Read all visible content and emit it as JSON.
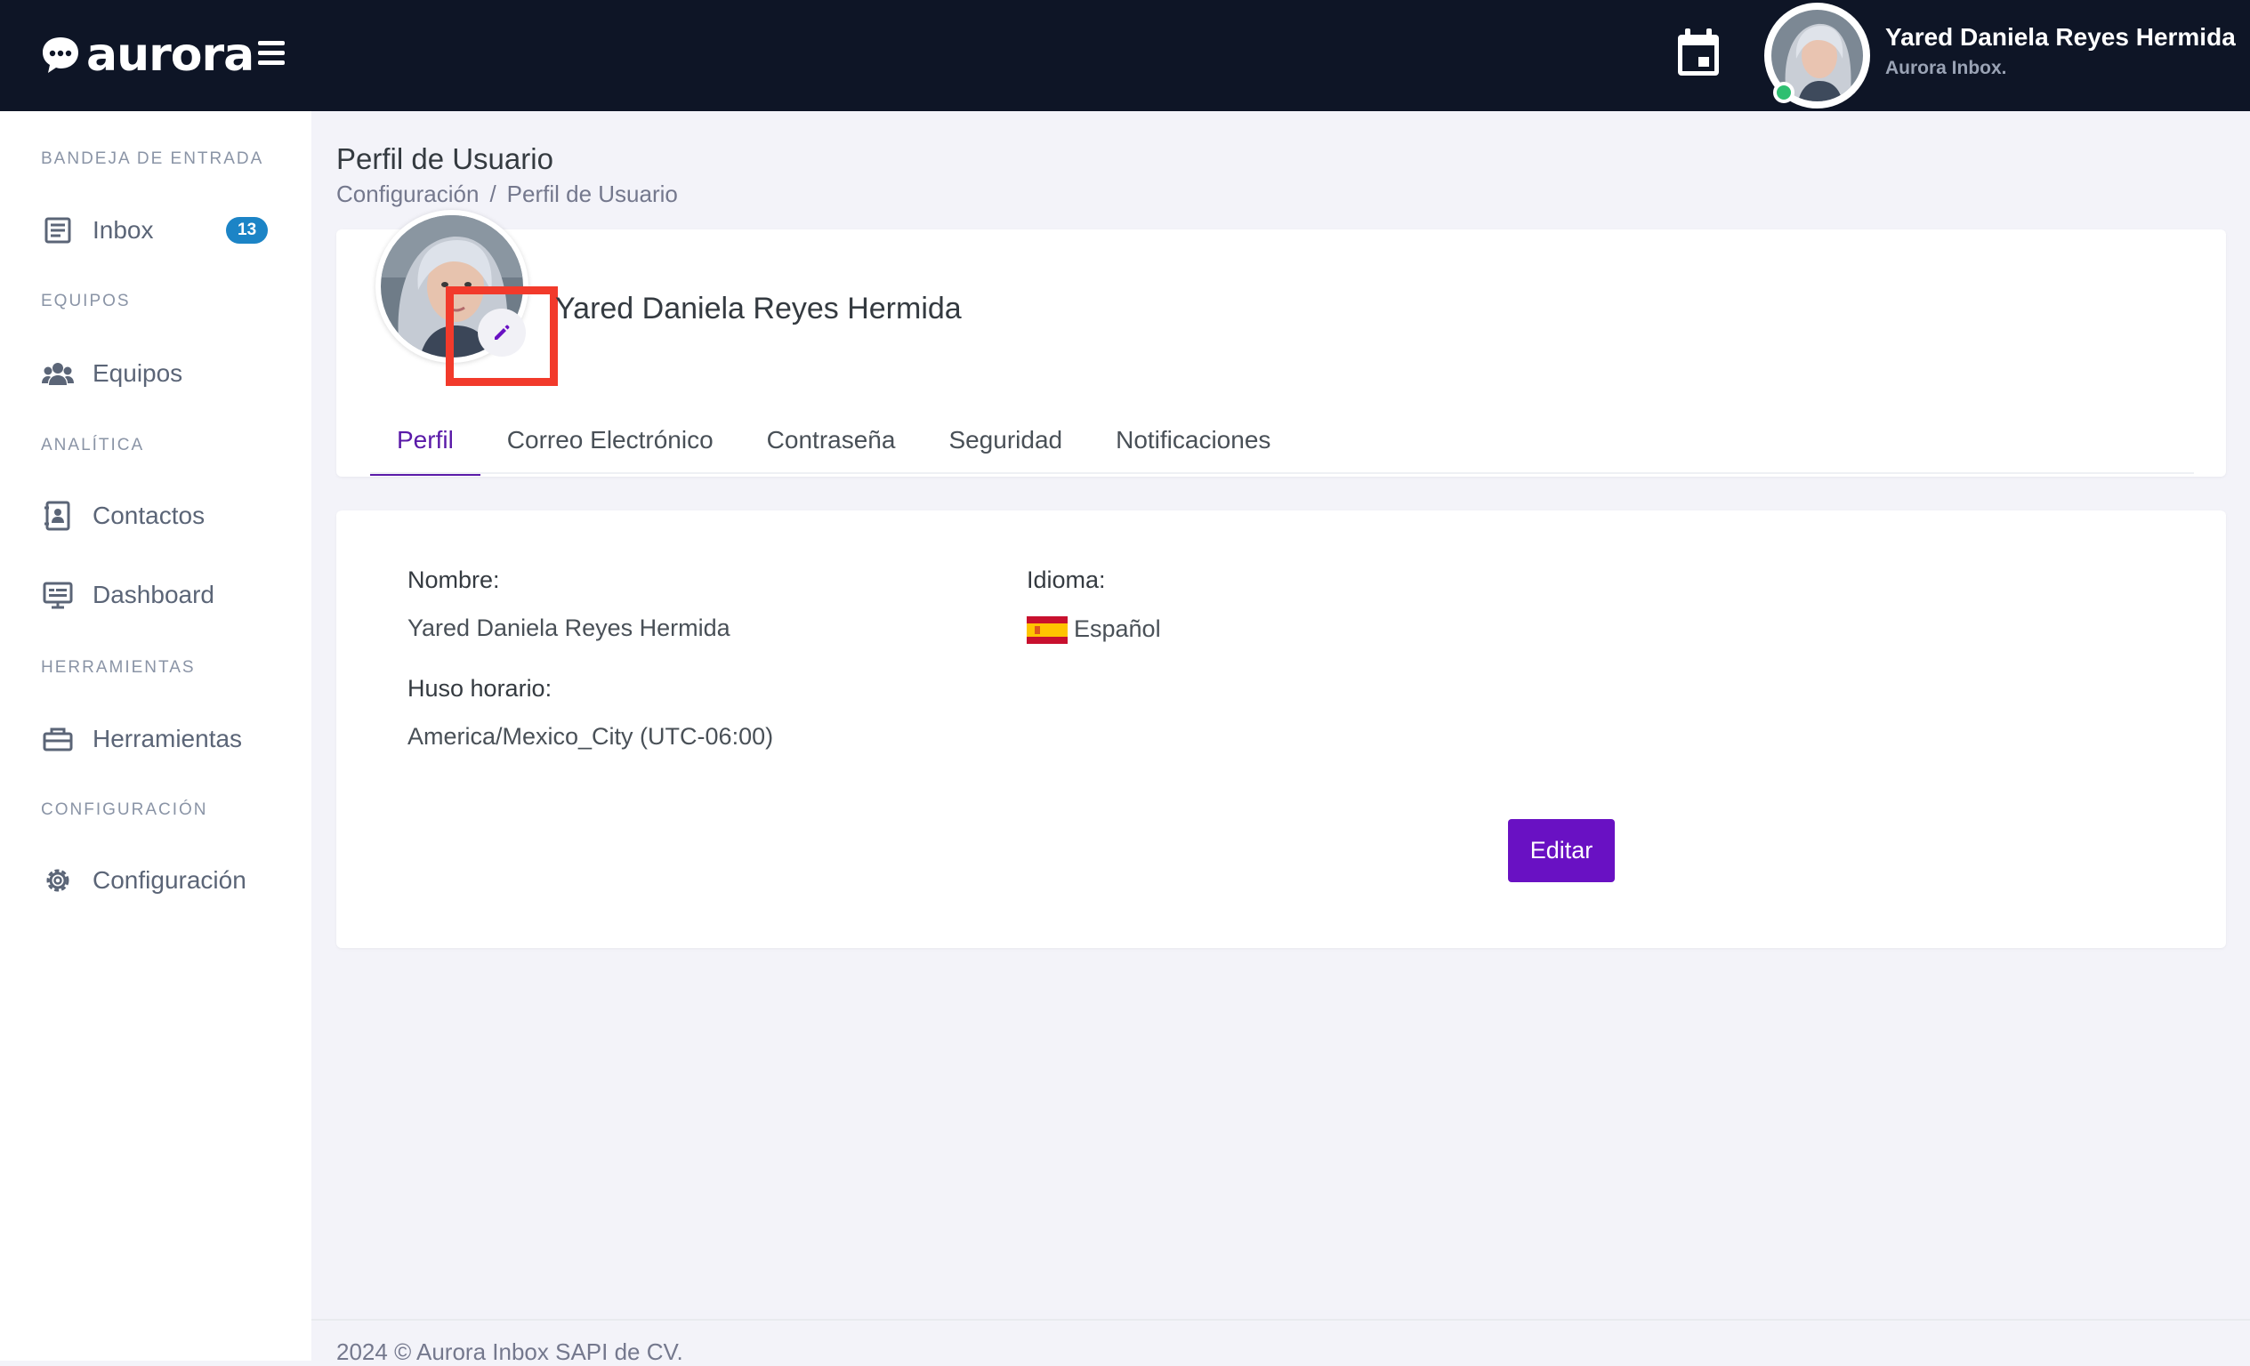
{
  "brand": {
    "name": "aurora"
  },
  "header": {
    "user_name": "Yared Daniela Reyes Hermida",
    "user_subtitle": "Aurora Inbox."
  },
  "sidebar": {
    "sections": [
      {
        "title": "Bandeja de entrada",
        "items": [
          {
            "label": "Inbox",
            "icon": "inbox-icon",
            "badge": "13"
          }
        ]
      },
      {
        "title": "Equipos",
        "items": [
          {
            "label": "Equipos",
            "icon": "users-icon"
          }
        ]
      },
      {
        "title": "Analítica",
        "items": [
          {
            "label": "Contactos",
            "icon": "contacts-icon"
          },
          {
            "label": "Dashboard",
            "icon": "monitor-icon"
          }
        ]
      },
      {
        "title": "Herramientas",
        "items": [
          {
            "label": "Herramientas",
            "icon": "toolbox-icon"
          }
        ]
      },
      {
        "title": "Configuración",
        "items": [
          {
            "label": "Configuración",
            "icon": "gear-icon"
          }
        ]
      }
    ]
  },
  "page": {
    "title": "Perfil de Usuario",
    "breadcrumb": [
      "Configuración",
      "Perfil de Usuario"
    ]
  },
  "profile": {
    "name": "Yared Daniela Reyes Hermida",
    "tabs": [
      "Perfil",
      "Correo Electrónico",
      "Contraseña",
      "Seguridad",
      "Notificaciones"
    ],
    "active_tab": "Perfil"
  },
  "details": {
    "name_label": "Nombre:",
    "name_value": "Yared Daniela Reyes Hermida",
    "language_label": "Idioma:",
    "language_value": "Español",
    "timezone_label": "Huso horario:",
    "timezone_value": "America/Mexico_City (UTC-06:00)",
    "edit_button": "Editar"
  },
  "footer": {
    "text": "2024 © Aurora Inbox SAPI de CV."
  },
  "colors": {
    "topbar": "#0e1526",
    "accent": "#6911c3",
    "badge": "#1c84c6",
    "highlight": "#f23a2b",
    "online": "#2fbf71"
  }
}
